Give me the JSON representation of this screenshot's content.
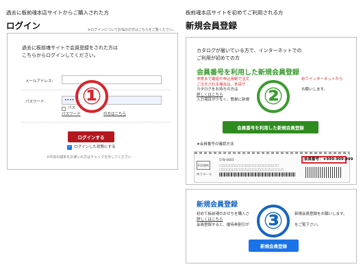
{
  "login": {
    "subtitle": "過去に板前魂本店サイトからご購入された方",
    "title": "ログイン",
    "top_note": "※ログインについてお悩みの方はこちらをご覧ください。",
    "intro": [
      "過去に板前魂サイトで会員登録をされた方は",
      "こちらからログインしてください。"
    ],
    "email_label": "メールアドレス:",
    "password_label": "パスワード:",
    "password_value": "••••",
    "show_password": "パス",
    "forgot_password": "パスワード",
    "forgot_password_tail": "の方はこちら",
    "login_button": "ログインする",
    "remember_me": "ログインした状態にする",
    "bottom_note": "※共有の端末をお使いの方はチェックを外してください",
    "marker": "①"
  },
  "register": {
    "subtitle": "板前魂本店サイトを初めてご利用される方",
    "title": "新規会員登録",
    "catalog_intro": [
      "カタログが届いている方で、インターネットでの",
      "ご利用が初めての方"
    ],
    "member_heading": "会員番号を利用した新規会員登録",
    "red_lines": [
      "非常まで電話や申込用紙で注文",
      "ご注文される場合は、本店サ"
    ],
    "red_right": "めてインターネットから",
    "dark_lines": [
      "カタログをお持ちの方は",
      "入力項目が少なく、簡単に新規"
    ],
    "dark_right": "お願いします。",
    "details_link": "詳しくはこちら",
    "member_button": "会員番号を利用した新規会員登録",
    "how_to_check": "★会員番号の確認方法",
    "member_number_label": "会員番号：★999-999-999",
    "postal_code": "578-0001",
    "address_lines": [
      "□□□□□□□□□□□□□□□□□□□□□□□",
      "□□□□□□□□□□□□□□□□□□□□□□□□□"
    ],
    "stamp": "料金後納",
    "mail_type": "ゆうメール",
    "marker": "②"
  },
  "new_member": {
    "heading": "新規会員登録",
    "line1": "初めて板前魂のおせちを購入さ",
    "line1_right": "新規会員登録をお願いします。",
    "details_link": "詳しくはこちら",
    "line2": "会員登録すると、優待券割引が",
    "line2_right": "をご覧下さい。",
    "button": "新規会員登録",
    "marker": "③"
  },
  "colors": {
    "red": "#d8232a",
    "green": "#3a9b2e",
    "green_button": "#2e8b1f",
    "blue": "#1565c0",
    "blue_button": "#1a73e8",
    "login_button": "#b3181f"
  }
}
